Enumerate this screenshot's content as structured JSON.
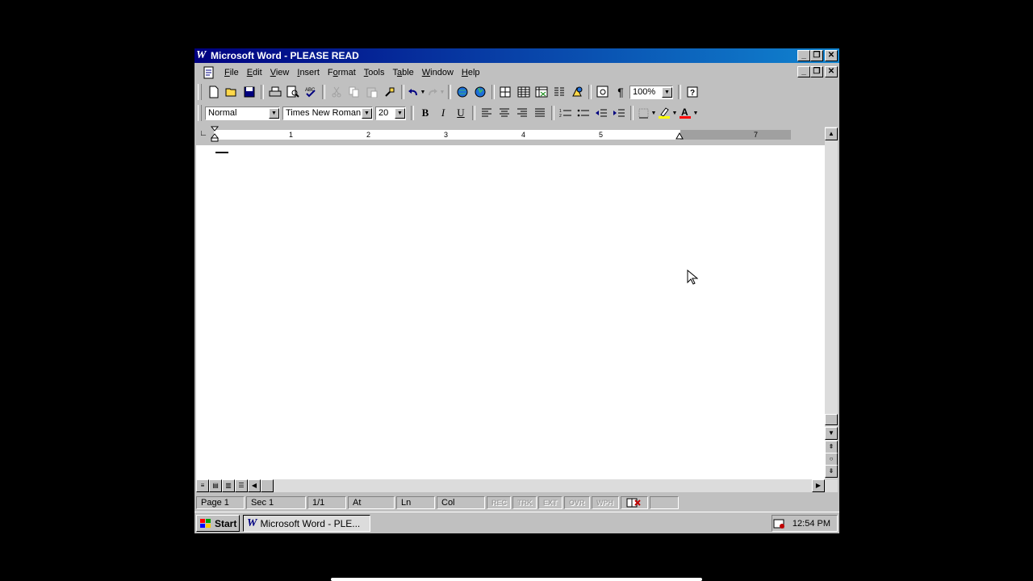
{
  "window": {
    "title": "Microsoft Word - PLEASE READ",
    "app_icon": "W"
  },
  "menu": {
    "items": [
      {
        "label": "File",
        "key": "F"
      },
      {
        "label": "Edit",
        "key": "E"
      },
      {
        "label": "View",
        "key": "V"
      },
      {
        "label": "Insert",
        "key": "I"
      },
      {
        "label": "Format",
        "key": "o"
      },
      {
        "label": "Tools",
        "key": "T"
      },
      {
        "label": "Table",
        "key": "a"
      },
      {
        "label": "Window",
        "key": "W"
      },
      {
        "label": "Help",
        "key": "H"
      }
    ]
  },
  "standard_toolbar": {
    "zoom": "100%"
  },
  "formatting_toolbar": {
    "style": "Normal",
    "font": "Times New Roman",
    "size": "20",
    "bold": "B",
    "italic": "I",
    "underline": "U",
    "font_color": "#ff0000",
    "highlight_color": "#ffff00"
  },
  "ruler": {
    "numbers": [
      "1",
      "2",
      "3",
      "4",
      "5",
      "7"
    ]
  },
  "status_bar": {
    "page": "Page 1",
    "sec": "Sec 1",
    "pages": "1/1",
    "at": "At",
    "ln": "Ln",
    "col": "Col",
    "indicators": [
      "REC",
      "TRK",
      "EXT",
      "OVR",
      "WPH"
    ]
  },
  "taskbar": {
    "start": "Start",
    "task": "Microsoft Word - PLE...",
    "clock": "12:54 PM"
  }
}
